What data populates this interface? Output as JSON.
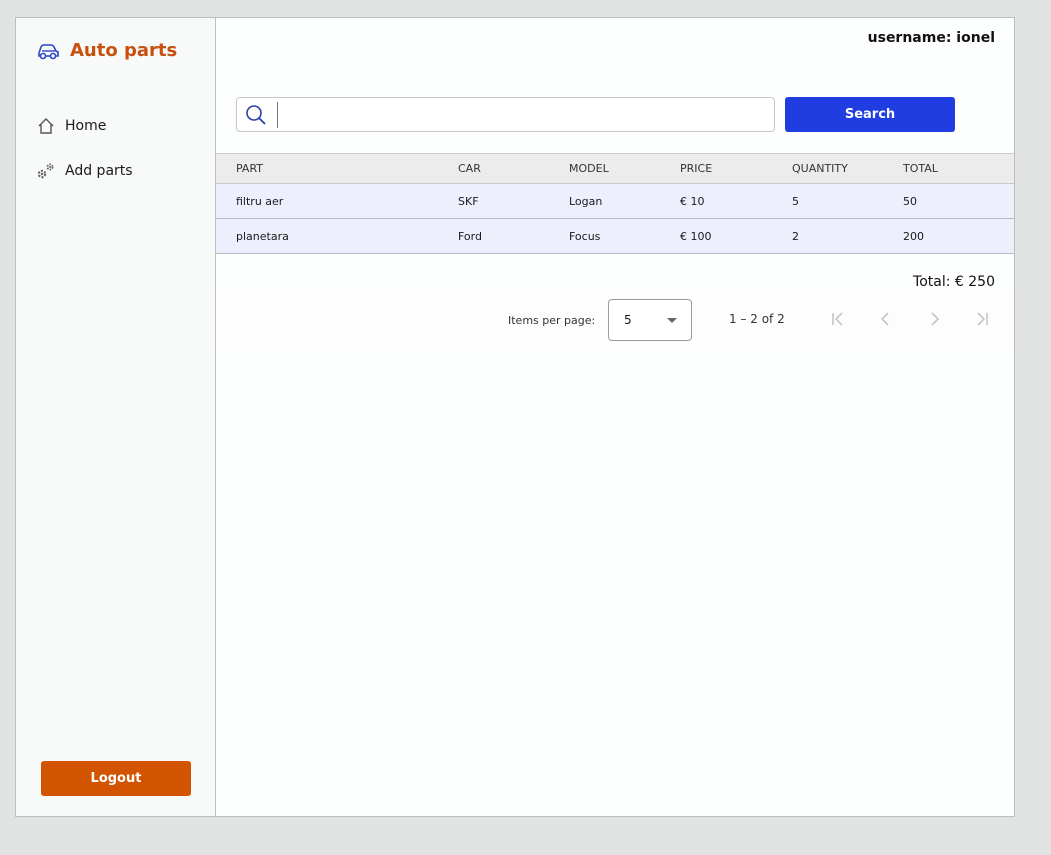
{
  "app": {
    "brand": "Auto parts"
  },
  "sidebar": {
    "items": [
      {
        "label": "Home",
        "icon": "home-icon"
      },
      {
        "label": "Add parts",
        "icon": "gears-icon"
      }
    ],
    "logout_label": "Logout"
  },
  "header": {
    "username": "username: ionel"
  },
  "search": {
    "value": "",
    "placeholder": "",
    "button_label": "Search"
  },
  "table": {
    "headers": [
      "PART",
      "CAR",
      "MODEL",
      "PRICE",
      "QUANTITY",
      "TOTAL"
    ],
    "rows": [
      [
        "filtru aer",
        "SKF",
        "Logan",
        "€ 10",
        "5",
        "50"
      ],
      [
        "planetara",
        "Ford",
        "Focus",
        "€ 100",
        "2",
        "200"
      ]
    ]
  },
  "total": "Total: € 250",
  "paginator": {
    "items_per_page_label": "Items per page:",
    "items_per_page_value": "5",
    "range_label": "1 – 2 of 2"
  },
  "colors": {
    "brand": "#c7500e",
    "primary": "#1f3de0",
    "logout": "#d35400",
    "row_bg": "#eeeffc"
  }
}
